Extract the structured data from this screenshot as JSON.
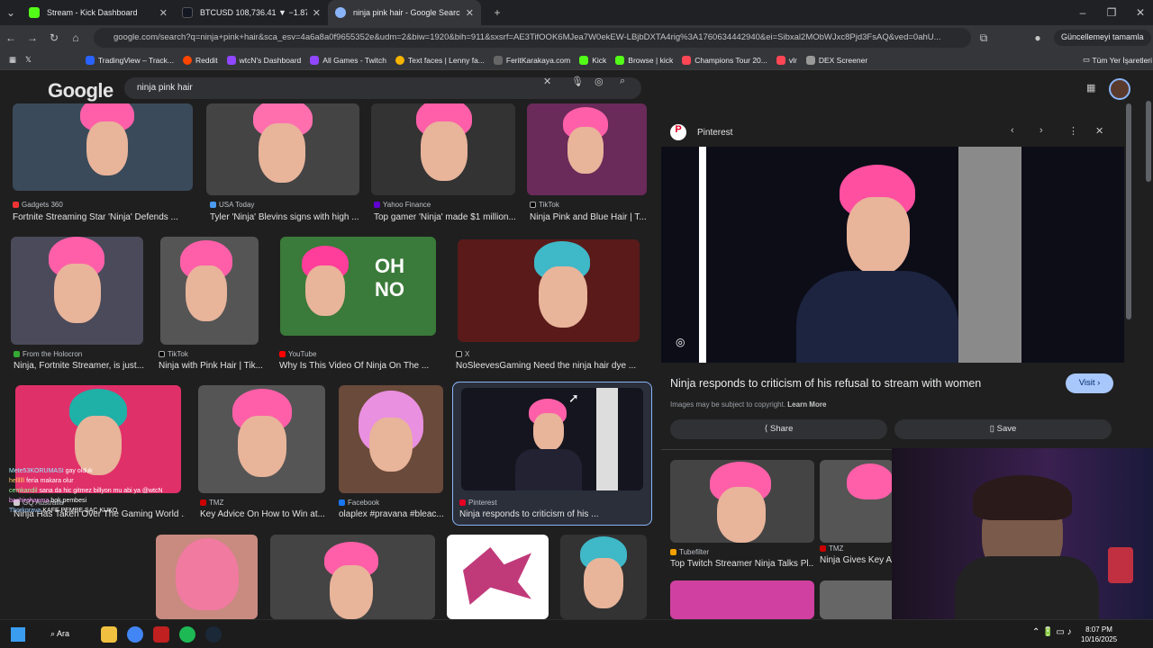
{
  "tabs": [
    {
      "label": "Stream - Kick Dashboard",
      "color": "#53fc18"
    },
    {
      "label": "BTCUSD 108,736.41 ▼ −1.87%",
      "color": "#131722"
    },
    {
      "label": "ninja pink hair - Google Search",
      "color": "#8ab4f8"
    }
  ],
  "address": {
    "url": "google.com/search?q=ninja+pink+hair&sca_esv=4a6a8a0f9655352e&udm=2&biw=1920&bih=911&sxsrf=AE3TifOOK6MJea7W0ekEW-LBjbDXTA4rig%3A1760634442940&ei=Sibxal2MObWJxc8Pjd3FsAQ&ved=0ahU...",
    "update_label": "Güncellemeyi tamamla"
  },
  "bookmarks": [
    {
      "label": "TradingView – Track...",
      "color": "#2962ff"
    },
    {
      "label": "Reddit",
      "color": "#ff4500"
    },
    {
      "label": "wtcN's Dashboard",
      "color": "#9146ff"
    },
    {
      "label": "All Games - Twitch",
      "color": "#9146ff"
    },
    {
      "label": "Text faces | Lenny fa...",
      "color": "#f4b400"
    },
    {
      "label": "FeritKarakaya.com",
      "color": "#444"
    },
    {
      "label": "Kick",
      "color": "#53fc18"
    },
    {
      "label": "Browse | kick",
      "color": "#53fc18"
    },
    {
      "label": "Champions Tour 20...",
      "color": "#ff4655"
    },
    {
      "label": "vlr",
      "color": "#ff4655"
    },
    {
      "label": "DEX Screener",
      "color": "#999"
    }
  ],
  "bookmarks_all": "Tüm Yer İşaretleri",
  "search": {
    "logo": "Google",
    "query": "ninja pink hair"
  },
  "results": [
    {
      "source": "Gadgets 360",
      "title": "Fortnite Streaming Star 'Ninja' Defends ...",
      "bg": "#3a4a5a"
    },
    {
      "source": "USA Today",
      "title": "Tyler 'Ninja' Blevins signs with high ...",
      "bg": "#444"
    },
    {
      "source": "Yahoo Finance",
      "title": "Top gamer 'Ninja' made $1 million...",
      "bg": "#333"
    },
    {
      "source": "TikTok",
      "title": "Ninja Pink and Blue Hair | T...",
      "bg": "#6a2a5a"
    },
    {
      "source": "From the Holocron",
      "title": "Ninja, Fortnite Streamer, is just...",
      "bg": "#4a4a5a"
    },
    {
      "source": "TikTok",
      "title": "Ninja with Pink Hair | Tik...",
      "bg": "#555"
    },
    {
      "source": "YouTube",
      "title": "Why Is This Video Of Ninja On The ...",
      "bg": "#3a7a3a",
      "overlay": "OH NO"
    },
    {
      "source": "X",
      "title": "NoSleevesGaming Need the ninja hair dye ...",
      "bg": "#5a1a1a"
    },
    {
      "source": "GQ Australia",
      "title": "Ninja Has Taken Over The Gaming World ...",
      "bg": "#e0306a"
    },
    {
      "source": "TMZ",
      "title": "Key Advice On How to Win at...",
      "bg": "#555"
    },
    {
      "source": "Facebook",
      "title": "olaplex #pravana #bleac...",
      "bg": "#6a4a3a"
    },
    {
      "source": "Pinterest",
      "title": "Ninja responds to criticism of his ...",
      "bg": "#15151f"
    }
  ],
  "panel": {
    "source": "Pinterest",
    "title": "Ninja responds to criticism of his refusal to stream with women",
    "visit": "Visit",
    "copyright": "Images may be subject to copyright.",
    "learn_more": "Learn More",
    "share": "Share",
    "save": "Save",
    "related": [
      {
        "source": "Tubefilter",
        "title": "Top Twitch Streamer Ninja Talks Pl..."
      },
      {
        "source": "TMZ",
        "title": "Ninja Gives Key Ad..."
      }
    ]
  },
  "chat": [
    {
      "user": "Mete53KORUMASI",
      "text": "gay olduk"
    },
    {
      "user": "hellllll",
      "text": "feria makara olur"
    },
    {
      "user": "cemkandil",
      "text": "sana da hic gitmez billyon mu abi ya @wtcN"
    },
    {
      "user": "bachirahanma",
      "text": "bok pembesi"
    },
    {
      "user": "Thorkorava",
      "text": "KAFE PEMBE SAC KUKO"
    }
  ],
  "taskbar": {
    "search": "Ara",
    "time": "8:07 PM",
    "date": "10/16/2025"
  }
}
